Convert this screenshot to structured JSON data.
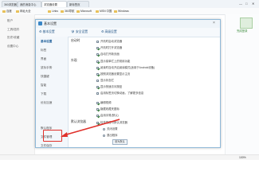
{
  "browser": {
    "tabs": [
      {
        "label": "360浏览器"
      },
      {
        "label": "我的消息中心"
      },
      {
        "label": "浏览器设置"
      },
      {
        "label": "新标签页"
      }
    ],
    "window_controls": [
      "—",
      "□",
      "✕"
    ]
  },
  "bookmarks": [
    {
      "label": "百度"
    },
    {
      "label": "网址大全"
    },
    {
      "label": "Links"
    },
    {
      "label": "360导航"
    },
    {
      "label": "Microsoft"
    },
    {
      "label": "MSN 中国"
    },
    {
      "label": "Windows"
    }
  ],
  "left_sidebar": {
    "items": [
      {
        "label": "账户"
      },
      {
        "label": "工具/插件"
      },
      {
        "label": "历史/收藏"
      },
      {
        "label": "设置中心"
      }
    ]
  },
  "dialog": {
    "title": "基本设置",
    "toolbar": {
      "basic_label": "基本设置",
      "security_label": "安全设置",
      "advanced_label": "高级设置"
    },
    "nav": [
      {
        "label": "基本设置"
      },
      {
        "label": "标签"
      },
      {
        "label": "界面"
      },
      {
        "label": "鼠标手势"
      },
      {
        "label": "快捷键"
      },
      {
        "label": "智能"
      },
      {
        "label": "下载"
      },
      {
        "label": "优化加速"
      },
      {
        "label": "默认程序"
      },
      {
        "label": "文件管理"
      },
      {
        "label": "文件保存"
      },
      {
        "label": "隐私设置"
      }
    ],
    "sections": {
      "startup": "启动时",
      "appearance": "外观",
      "default_browser": "默认浏览器"
    },
    "options": [
      {
        "label": "开机时启动浏览器",
        "checked": false
      },
      {
        "label": "开机时打开浏览器",
        "checked": true
      },
      {
        "label": "自动打开新页面",
        "checked": true
      },
      {
        "label": "显示菜单栏上的常用功能",
        "checked": true
      },
      {
        "label": "阅读时自动开启阅读模式(适用于Android设备)",
        "checked": true
      },
      {
        "label": "按照浏览器设置显示主页",
        "checked": true
      },
      {
        "label": "显示状态栏",
        "checked": false
      },
      {
        "label": "显示快速访问按钮",
        "checked": true
      },
      {
        "label": "启用标签页切换动画，了解更多信息",
        "checked": false
      },
      {
        "label": "编辑视频",
        "checked": true
      },
      {
        "label": "隐藏收藏夹图标",
        "checked": true
      },
      {
        "label": "启用手势(默认)",
        "checked": true
      },
      {
        "label": "检查是否为默认浏览器",
        "checked": true
      }
    ],
    "sub_options": [
      {
        "label": "关闭设置",
        "selected": false
      },
      {
        "label": "退出程序",
        "selected": true
      }
    ],
    "set_default_label": "设为默认"
  },
  "right_panel": {
    "label": "完成登录"
  },
  "status": {
    "zoom": "100%"
  }
}
